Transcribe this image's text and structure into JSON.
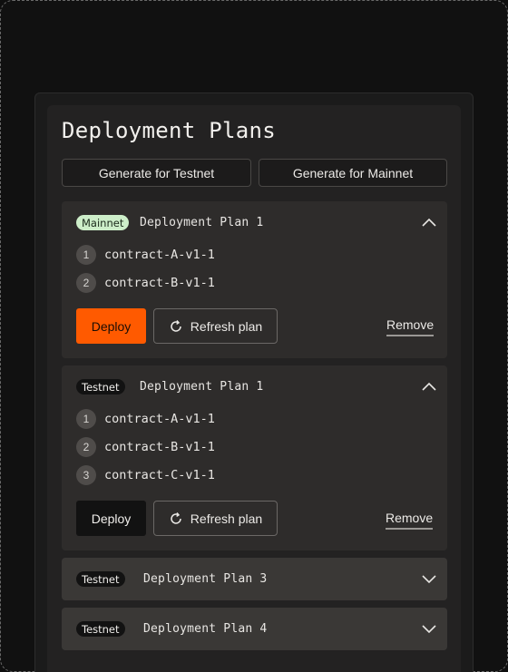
{
  "header": {
    "title": "Deployment Plans",
    "generate_testnet": "Generate for Testnet",
    "generate_mainnet": "Generate for Mainnet"
  },
  "plans": [
    {
      "badge": "Mainnet",
      "name": "Deployment Plan 1",
      "expanded": true,
      "items": [
        {
          "num": "1",
          "label": "contract-A-v1-1"
        },
        {
          "num": "2",
          "label": "contract-B-v1-1"
        }
      ],
      "deploy_label": "Deploy",
      "refresh_label": "Refresh plan",
      "remove_label": "Remove"
    },
    {
      "badge": "Testnet",
      "name": "Deployment Plan 1",
      "expanded": true,
      "items": [
        {
          "num": "1",
          "label": "contract-A-v1-1"
        },
        {
          "num": "2",
          "label": "contract-B-v1-1"
        },
        {
          "num": "3",
          "label": "contract-C-v1-1"
        }
      ],
      "deploy_label": "Deploy",
      "refresh_label": "Refresh plan",
      "remove_label": "Remove"
    },
    {
      "badge": "Testnet",
      "name": "Deployment Plan 3",
      "expanded": false
    },
    {
      "badge": "Testnet",
      "name": "Deployment Plan 4",
      "expanded": false
    }
  ],
  "colors": {
    "accent_deploy": "#ff5a00",
    "mainnet_badge": "#cdeec9",
    "testnet_badge": "#121212"
  },
  "icons": {
    "collapse": "chevron-up-icon",
    "expand": "chevron-down-icon",
    "refresh": "refresh-icon"
  }
}
